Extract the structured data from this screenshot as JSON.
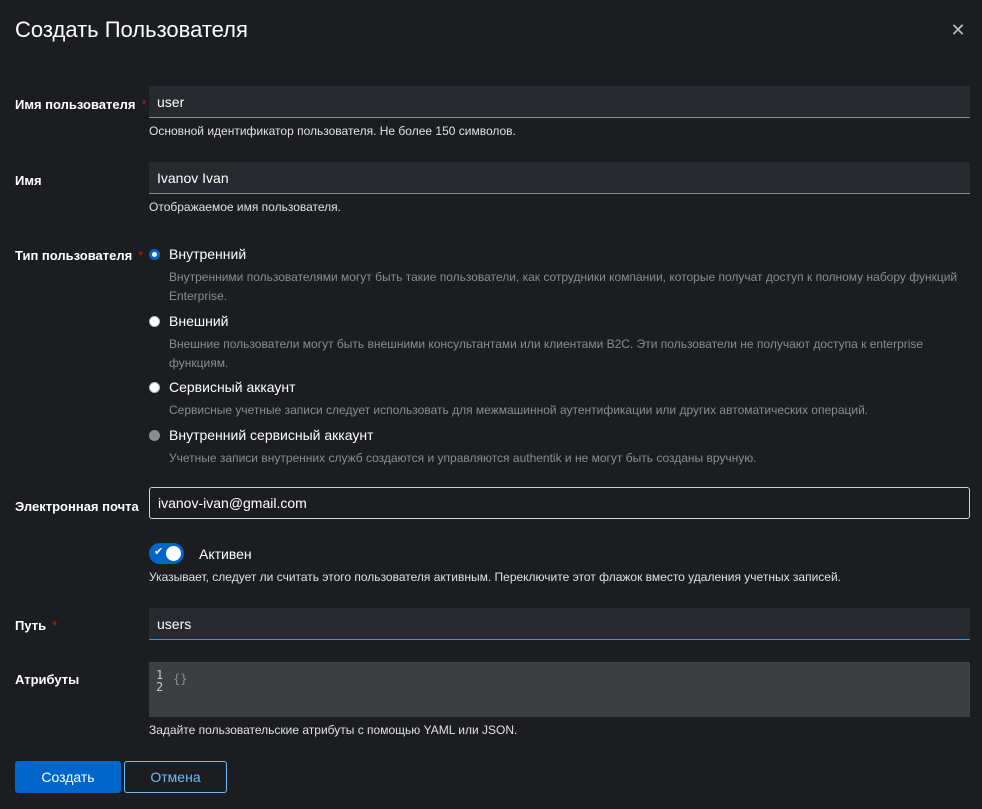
{
  "dialog": {
    "title": "Создать Пользователя",
    "close_icon": "close-icon"
  },
  "username": {
    "label": "Имя пользователя",
    "required": "*",
    "value": "user",
    "helper": "Основной идентификатор пользователя. Не более 150 символов."
  },
  "name": {
    "label": "Имя",
    "value": "Ivanov Ivan",
    "helper": "Отображаемое имя пользователя."
  },
  "user_type": {
    "label": "Тип пользователя",
    "required": "*",
    "options": [
      {
        "label": "Внутренний",
        "description": "Внутренними пользователями могут быть такие пользователи, как сотрудники компании, которые получат доступ к полному набору функций Enterprise.",
        "checked": true
      },
      {
        "label": "Внешний",
        "description": "Внешние пользователи могут быть внешними консультантами или клиентами B2C. Эти пользователи не получают доступа к enterprise функциям.",
        "checked": false
      },
      {
        "label": "Сервисный аккаунт",
        "description": "Сервисные учетные записи следует использовать для межмашинной аутентификации или других автоматических операций.",
        "checked": false
      },
      {
        "label": "Внутренний сервисный аккаунт",
        "description": "Учетные записи внутренних служб создаются и управляются authentik и не могут быть созданы вручную.",
        "checked": false,
        "disabled": true
      }
    ]
  },
  "email": {
    "label": "Электронная почта",
    "value": "ivanov-ivan@gmail.com"
  },
  "active": {
    "label": "Активен",
    "checked": true,
    "helper": "Указывает, следует ли считать этого пользователя активным. Переключите этот флажок вместо удаления учетных записей."
  },
  "path": {
    "label": "Путь",
    "required": "*",
    "value": "users"
  },
  "attributes": {
    "label": "Атрибуты",
    "line_numbers": [
      "1",
      "2"
    ],
    "content": "{}",
    "helper": "Задайте пользовательские атрибуты с помощью YAML или JSON."
  },
  "buttons": {
    "submit": "Создать",
    "cancel": "Отмена"
  },
  "colors": {
    "accent": "#0066cc",
    "background": "#1b1d21",
    "required": "#c9190b"
  }
}
